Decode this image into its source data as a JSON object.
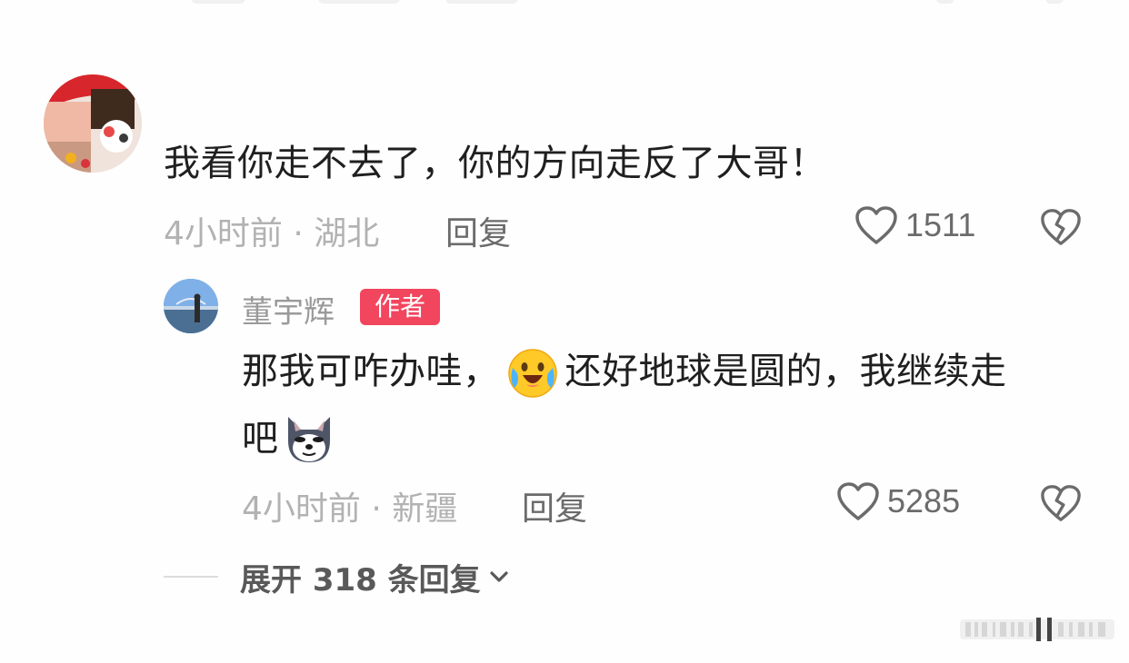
{
  "comment": {
    "text": "我看你走不去了，你的方向走反了大哥！",
    "meta": "4小时前 · 湖北",
    "reply_label": "回复",
    "like_count": "1511"
  },
  "reply": {
    "author": "董宇辉",
    "badge": "作者",
    "text_part1": "那我可咋办哇，",
    "text_part2": "还好地球是圆的，我继续走",
    "text_line2": "吧",
    "meta": "4小时前 · 新疆",
    "reply_label": "回复",
    "like_count": "5285"
  },
  "expand": {
    "label": "展开 318 条回复"
  },
  "icons": {
    "like": "heart-outline-icon",
    "dislike": "broken-heart-icon",
    "expand": "chevron-down-icon",
    "emoji1": "crying-laughing-emoji",
    "emoji2": "wolf-emoji"
  },
  "colors": {
    "badge": "#f2455e",
    "text": "#1f1f1f",
    "meta": "#b2b2b2",
    "action": "#6b6b6b"
  }
}
